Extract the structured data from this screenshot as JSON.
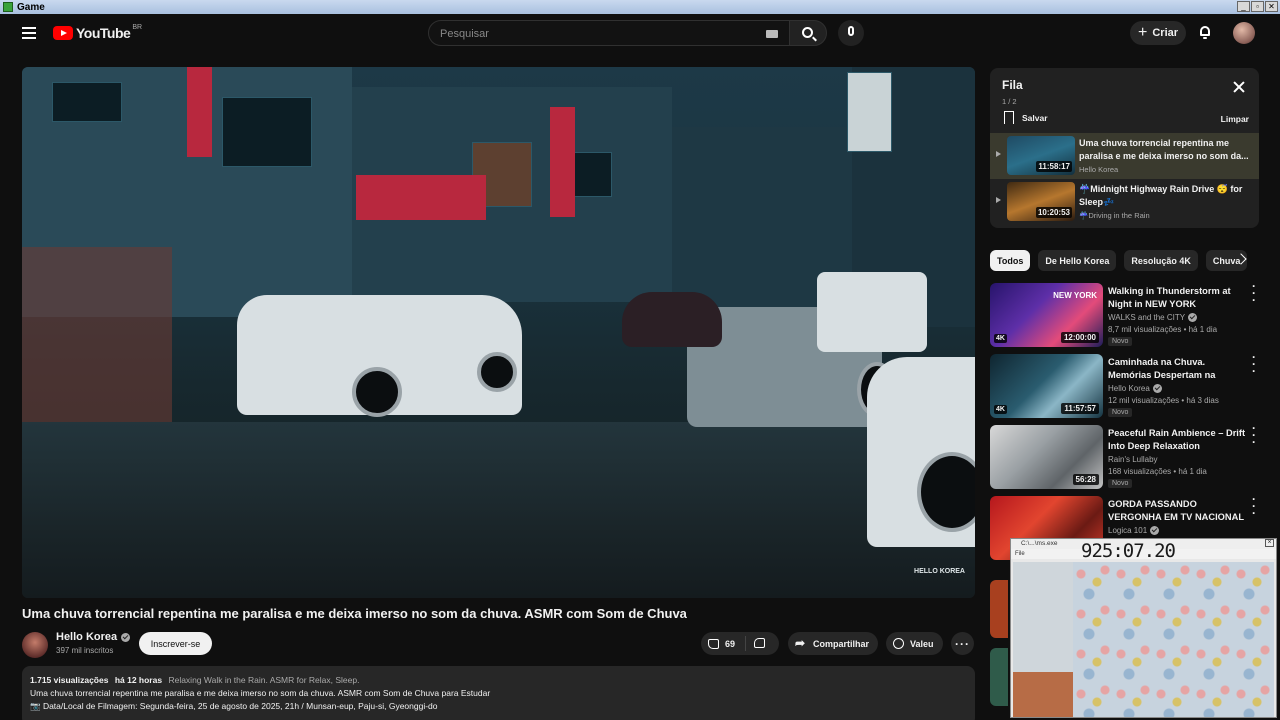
{
  "window": {
    "title": "Game",
    "buttons": [
      "_",
      "▫",
      "✕"
    ]
  },
  "header": {
    "logo_text": "YouTube",
    "region": "BR",
    "search_placeholder": "Pesquisar",
    "create_label": "Criar"
  },
  "video": {
    "watermark": "HELLO KOREA",
    "title": "Uma chuva torrencial repentina me paralisa e me deixa imerso no som da chuva. ASMR com Som de Chuva",
    "channel": "Hello Korea",
    "subscribers": "397 mil inscritos",
    "subscribe_label": "Inscrever-se",
    "likes": "69",
    "share_label": "Compartilhar",
    "thanks_label": "Valeu",
    "more_label": "···"
  },
  "description": {
    "views": "1.715 visualizações",
    "age": "há 12 horas",
    "tags": "Relaxing Walk in the Rain. ASMR for Relax, Sleep.",
    "line1": "Uma chuva torrencial repentina me paralisa e me deixa imerso no som da chuva. ASMR com Som de Chuva para Estudar",
    "line2": "📷 Data/Local de Filmagem: Segunda-feira, 25 de agosto de 2025, 21h / Munsan-eup, Paju-si, Gyeonggi-do"
  },
  "queue": {
    "title": "Fila",
    "count": "1 / 2",
    "save_label": "Salvar",
    "clear_label": "Limpar",
    "items": [
      {
        "title": "Uma chuva torrencial repentina me paralisa e me deixa imerso no som da...",
        "channel": "Hello Korea",
        "duration": "11:58:17"
      },
      {
        "title": "☔Midnight Highway Rain Drive 😴 for Sleep💤",
        "channel": "☔Driving in the Rain",
        "duration": "10:20:53"
      }
    ]
  },
  "chips": [
    "Todos",
    "De Hello Korea",
    "Resolução 4K",
    "Chuva"
  ],
  "recommendations": [
    {
      "title": "Walking in Thunderstorm at Night in NEW YORK",
      "channel": "WALKS and the CITY",
      "views": "8,7 mil visualizações • há 1 dia",
      "badge": "Novo",
      "duration": "12:00:00",
      "quality": "4K",
      "thumb_overlay": "NEW YORK"
    },
    {
      "title": "Caminhada na Chuva. Memórias Despertam na Chuva...",
      "channel": "Hello Korea",
      "views": "12 mil visualizações • há 3 dias",
      "badge": "Novo",
      "duration": "11:57:57",
      "quality": "4K",
      "thumb_overlay": ""
    },
    {
      "title": "Peaceful Rain Ambience – Drift Into Deep Relaxation",
      "channel": "Rain's Lullaby",
      "views": "168 visualizações • há 1 dia",
      "badge": "Novo",
      "duration": "56:28",
      "quality": "",
      "thumb_overlay": ""
    },
    {
      "title": "GORDA PASSANDO VERGONHA EM TV NACIONAL",
      "channel": "Logica 101",
      "views": "",
      "badge": "",
      "duration": "",
      "quality": "",
      "thumb_overlay": ""
    }
  ],
  "webcam": {
    "window_label": "C:\\...\\ms.exe",
    "menu_label": "File",
    "counter": "925:07.20"
  }
}
